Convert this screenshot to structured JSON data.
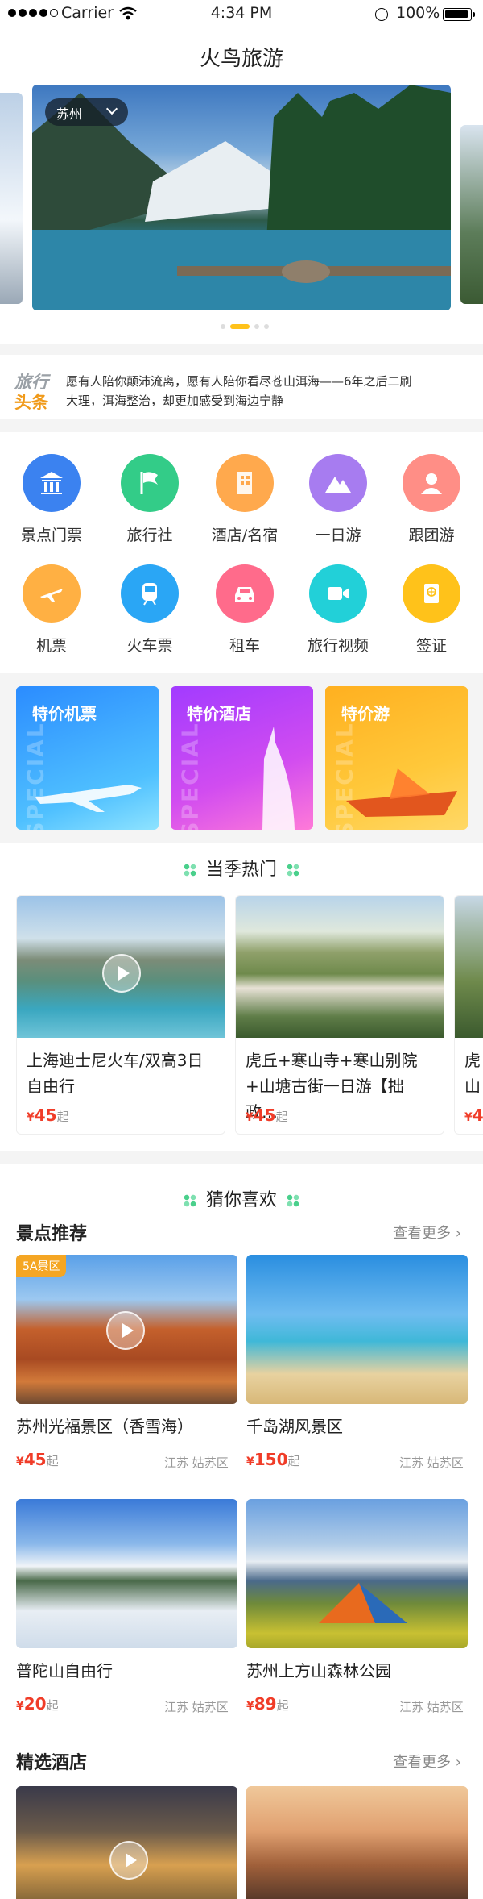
{
  "status": {
    "carrier": "Carrier",
    "time": "4:34 PM",
    "battery": "100%"
  },
  "app_title": "火鸟旅游",
  "banner": {
    "city": "苏州",
    "page_count": 4,
    "active_page": 1
  },
  "news": {
    "logo_line1": "旅行",
    "logo_line2": "头条",
    "line1": "愿有人陪你颠沛流离，愿有人陪你看尽苍山洱海——6年之后二刷",
    "line2": "大理，洱海整治，却更加感受到海边宁静"
  },
  "categories": [
    {
      "label": "景点门票",
      "icon": "temple-icon",
      "color": "#3b82f0"
    },
    {
      "label": "旅行社",
      "icon": "flag-icon",
      "color": "#33cc88"
    },
    {
      "label": "酒店/名宿",
      "icon": "building-icon",
      "color": "#ffa94d"
    },
    {
      "label": "一日游",
      "icon": "mountain-icon",
      "color": "#a77cf0"
    },
    {
      "label": "跟团游",
      "icon": "user-icon",
      "color": "#ff8e86"
    },
    {
      "label": "机票",
      "icon": "plane-icon",
      "color": "#ffb043"
    },
    {
      "label": "火车票",
      "icon": "train-icon",
      "color": "#2aa6f5"
    },
    {
      "label": "租车",
      "icon": "car-icon",
      "color": "#ff6b8b"
    },
    {
      "label": "旅行视频",
      "icon": "video-icon",
      "color": "#22d0d8"
    },
    {
      "label": "签证",
      "icon": "passport-icon",
      "color": "#ffc21a"
    }
  ],
  "deals": [
    {
      "title": "特价机票",
      "watermark": "SPECIAL"
    },
    {
      "title": "特价酒店",
      "watermark": "SPECIAL"
    },
    {
      "title": "特价游",
      "watermark": "SPECIAL"
    }
  ],
  "season_hot": {
    "title": "当季热门",
    "items": [
      {
        "name": "上海迪士尼火车/双高3日自由行",
        "price": "45",
        "unit": "起",
        "currency": "¥"
      },
      {
        "name": "虎丘+寒山寺+寒山别院+山塘古街一日游【拙政…",
        "price": "45",
        "unit": "起",
        "currency": "¥"
      },
      {
        "name": "虎山",
        "price": "4",
        "unit": "",
        "currency": "¥"
      }
    ]
  },
  "guess": {
    "title": "猜你喜欢"
  },
  "spots": {
    "title": "景点推荐",
    "more": "查看更多",
    "items": [
      {
        "name": "苏州光福景区（香雪海）",
        "price": "45",
        "unit": "起",
        "currency": "¥",
        "location": "江苏 姑苏区",
        "badge": "5A景区"
      },
      {
        "name": "千岛湖风景区",
        "price": "150",
        "unit": "起",
        "currency": "¥",
        "location": "江苏 姑苏区"
      },
      {
        "name": "普陀山自由行",
        "price": "20",
        "unit": "起",
        "currency": "¥",
        "location": "江苏 姑苏区"
      },
      {
        "name": "苏州上方山森林公园",
        "price": "89",
        "unit": "起",
        "currency": "¥",
        "location": "江苏 姑苏区"
      }
    ]
  },
  "hotels": {
    "title": "精选酒店",
    "more": "查看更多"
  }
}
